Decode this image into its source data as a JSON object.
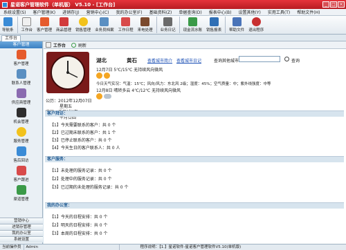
{
  "window": {
    "title": "星诺客户管理软件（单机版） V5.10 - [工作台]"
  },
  "menu": [
    "系统设置(S)",
    "客户管理(K)",
    "进销存(J)",
    "营销中心(C)",
    "我的办公室(F)",
    "基础资料(Z)",
    "单据查询(D)",
    "报表中心(B)",
    "设置其他(Y)",
    "实用工具(T)",
    "帮助文件(H)"
  ],
  "toolbar": [
    "导航条",
    "工作台",
    "客户管理",
    "商品管理",
    "销售管理",
    "业务员档案",
    "工作日程",
    "来电处理",
    "业务日记",
    "现金流水账",
    "销售报表",
    "帮助文件",
    "退出程序"
  ],
  "tab": {
    "label": "工作台"
  },
  "sidebar": {
    "header": "客户管理",
    "items": [
      "客户管理",
      "联系人管理",
      "供应商管理",
      "机会管理",
      "服务管理",
      "售后回访",
      "客户跟进",
      "渠道管理"
    ],
    "groups": [
      "营销中心",
      "进销存管理",
      "我的办公室",
      "系统设置"
    ]
  },
  "main": {
    "toolbar": {
      "title": "工作台",
      "refresh": "刷新"
    },
    "date": {
      "gregorian": "公历：2012年12月07日",
      "weekday": "星期五",
      "lunar": "农历：壬辰(龙)年",
      "lunar_day": "十月廿四"
    },
    "weather": {
      "province": "湖北",
      "city": "黄石",
      "link_intro": "查看城市简介",
      "link_diary": "查看城市日记",
      "search_label": "查询其他城市",
      "search_button": "查询",
      "day1": "12月7日 5℃/15℃ 无持续风向微风",
      "today": "今日天气实况：气温：15℃；风向/风力：东北风 2级；湿度：45%；空气质量：中；紫外线强度：中等",
      "day2": "12月8日 晴转多云 4℃/12℃ 无持续风向微风"
    },
    "sections": [
      {
        "title": "客户拜访：",
        "rows": [
          "【1】今天需要联系的客户：共 0 个",
          "【2】已过期未联系的客户：共 1 个",
          "【3】已停止联系的客户：共 0 个",
          "【4】今天生日的客户联系人：共 0 人"
        ]
      },
      {
        "title": "客户服务：",
        "rows": [
          "【1】未处理的服务记录：共 0 个",
          "【2】处理中的服务记录：共 0 个",
          "【3】已过期的未处理的服务记录：共 0 个"
        ]
      },
      {
        "title": "我的办公室：",
        "rows": [
          "【1】今天的日程安排：共 0 个",
          "【2】明天的日程安排：共 0 个",
          "【3】本周的日程安排：共 0 个"
        ]
      }
    ]
  },
  "status": {
    "operator_label": "当前操作员",
    "operator": "Admin",
    "program": "程序说明：【1.】星诺软件-星诺客户管理软件V5.10(单机版)"
  }
}
